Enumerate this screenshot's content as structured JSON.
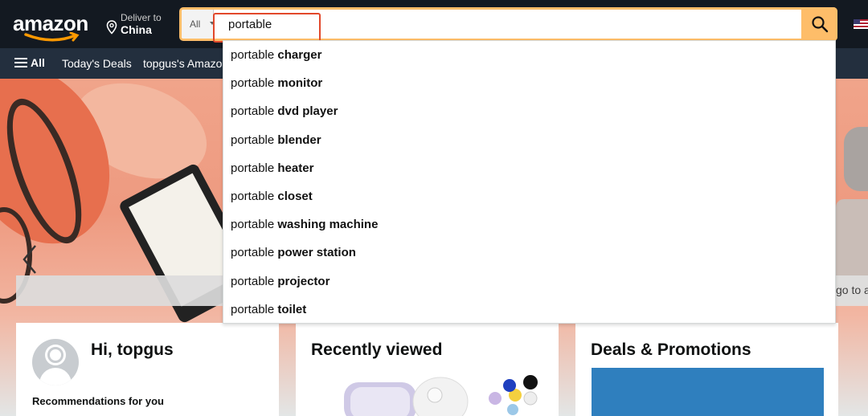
{
  "header": {
    "logo_text": "amazon",
    "deliver_label": "Deliver to",
    "deliver_location": "China",
    "search": {
      "category": "All",
      "value": "portable",
      "placeholder": ""
    },
    "icons": [
      "location-pin-icon",
      "search-icon",
      "us-flag-icon"
    ],
    "colors": {
      "header_bg": "#131921",
      "nav_bg": "#232f3e",
      "search_accent": "#febd69",
      "highlight": "#e2482b"
    }
  },
  "nav": {
    "all_label": "All",
    "items": [
      "Today's Deals",
      "topgus's Amazon"
    ]
  },
  "suggestions": [
    {
      "prefix": "portable",
      "completion": "charger"
    },
    {
      "prefix": "portable",
      "completion": "monitor"
    },
    {
      "prefix": "portable",
      "completion": "dvd player"
    },
    {
      "prefix": "portable",
      "completion": "blender"
    },
    {
      "prefix": "portable",
      "completion": "heater"
    },
    {
      "prefix": "portable",
      "completion": "closet"
    },
    {
      "prefix": "portable",
      "completion": "washing machine"
    },
    {
      "prefix": "portable",
      "completion": "power station"
    },
    {
      "prefix": "portable",
      "completion": "projector"
    },
    {
      "prefix": "portable",
      "completion": "toilet"
    }
  ],
  "hero": {
    "right_caption_fragment": "go to ar"
  },
  "cards": {
    "greeting": "Hi, topgus",
    "recommendations_label": "Recommendations for you",
    "recently_viewed_title": "Recently viewed",
    "deals_title": "Deals & Promotions"
  }
}
